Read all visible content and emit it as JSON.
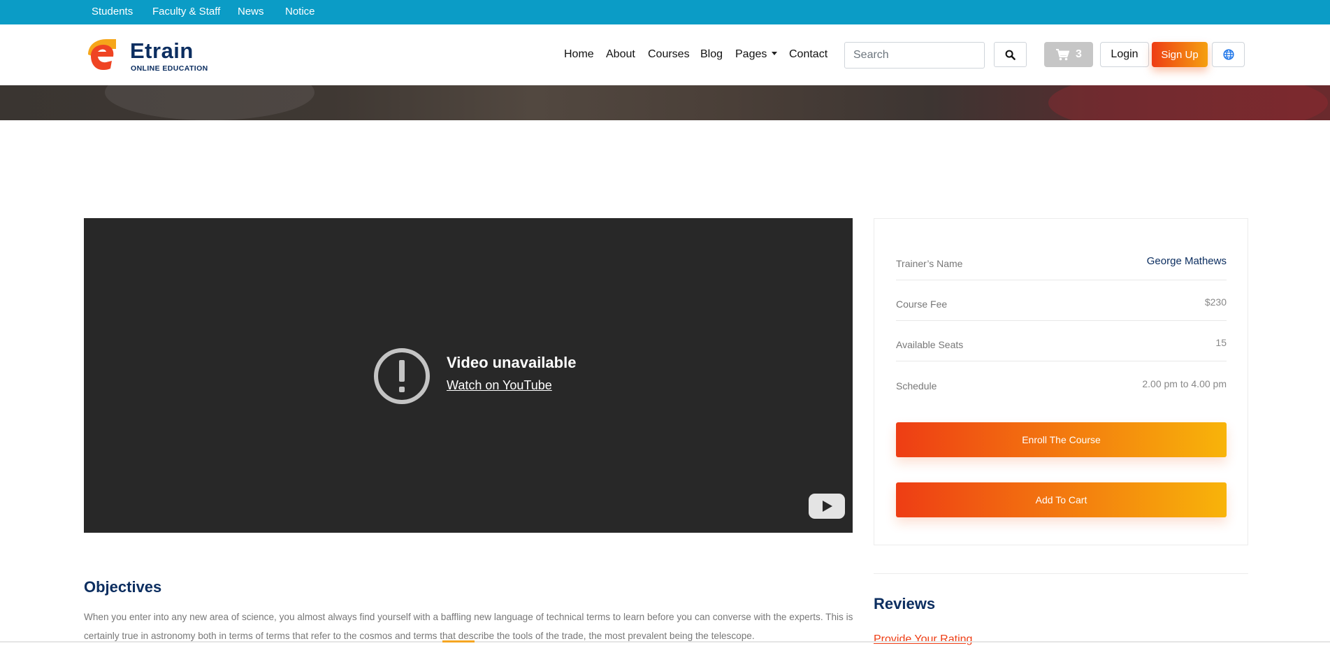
{
  "topbar": {
    "links": [
      "Students",
      "Faculty & Staff",
      "News",
      "Notice"
    ]
  },
  "brand": {
    "name": "Etrain",
    "tagline": "ONLINE EDUCATION",
    "colors": {
      "primary": "#0c2e60",
      "accent_start": "#ee3d14",
      "accent_end": "#f8b40a",
      "topbar": "#0b9cc6"
    }
  },
  "nav": {
    "home": "Home",
    "about": "About",
    "courses": "Courses",
    "blog": "Blog",
    "pages": "Pages",
    "contact": "Contact"
  },
  "header_actions": {
    "search_placeholder": "Search",
    "search_icon": "search-icon",
    "cart_icon": "cart-icon",
    "cart_count": "3",
    "login_label": "Login",
    "signup_label": "Sign Up",
    "language_icon": "globe-icon"
  },
  "video": {
    "title": "Video unavailable",
    "link": "Watch on YouTube"
  },
  "course_info": {
    "trainer_label": "Trainer’s Name",
    "trainer_value": "George Mathews",
    "fee_label": "Course Fee",
    "fee_value": "$230",
    "seats_label": "Available Seats",
    "seats_value": "15",
    "schedule_label": "Schedule",
    "schedule_value": "2.00 pm to 4.00 pm",
    "enroll_label": "Enroll The Course",
    "cart_label": "Add To Cart"
  },
  "objectives": {
    "title": "Objectives",
    "text": "When you enter into any new area of science, you almost always find yourself with a baffling new language of technical terms to learn before you can converse with the experts. This is certainly true in astronomy both in terms of terms that refer to the cosmos and terms that describe the tools of the trade, the most prevalent being the telescope."
  },
  "reviews": {
    "title": "Reviews",
    "rating_link": "Provide Your Rating"
  }
}
